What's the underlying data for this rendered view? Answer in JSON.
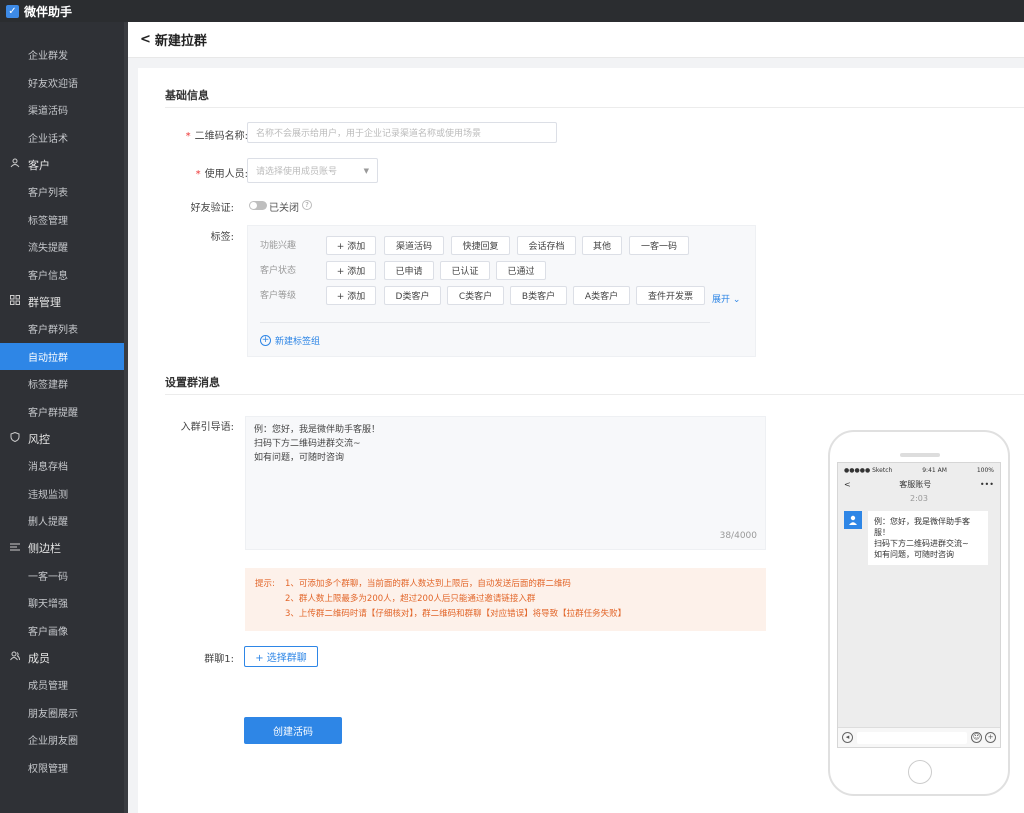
{
  "app": {
    "logo_glyph": "✓",
    "title": "微伴助手"
  },
  "sidebar": {
    "items_top": [
      "企业群发",
      "好友欢迎语",
      "渠道活码",
      "企业话术"
    ],
    "groups": [
      {
        "label": "客户",
        "icon": "person-icon",
        "items": [
          "客户列表",
          "标签管理",
          "流失提醒",
          "客户信息"
        ]
      },
      {
        "label": "群管理",
        "icon": "grid-icon",
        "items": [
          "客户群列表",
          "自动拉群",
          "标签建群",
          "客户群提醒"
        ]
      },
      {
        "label": "风控",
        "icon": "shield-icon",
        "items": [
          "消息存档",
          "违规监测",
          "删人提醒"
        ]
      },
      {
        "label": "侧边栏",
        "icon": "list-icon",
        "items": [
          "一客一码",
          "聊天增强",
          "客户画像"
        ]
      },
      {
        "label": "成员",
        "icon": "people-icon",
        "items": [
          "成员管理",
          "朋友圈展示",
          "企业朋友圈",
          "权限管理"
        ]
      }
    ],
    "active_item": "自动拉群"
  },
  "header": {
    "back_glyph": "<",
    "title": "新建拉群"
  },
  "basic": {
    "section_title": "基础信息",
    "qr_name_label": "二维码名称:",
    "qr_name_placeholder": "名称不会展示给用户，用于企业记录渠道名称或使用场景",
    "user_label": "使用人员:",
    "user_placeholder": "请选择使用成员账号",
    "verify_label": "好友验证:",
    "verify_state": "已关闭",
    "tags_label": "标签:",
    "tag_rows": [
      {
        "label": "功能兴趣",
        "chips": [
          "+ 添加",
          "渠道活码",
          "快捷回复",
          "会话存档",
          "其他",
          "一客一码"
        ]
      },
      {
        "label": "客户状态",
        "chips": [
          "+ 添加",
          "已申请",
          "已认证",
          "已通过"
        ]
      },
      {
        "label": "客户等级",
        "chips": [
          "+ 添加",
          "D类客户",
          "C类客户",
          "B类客户",
          "A类客户",
          "查件开发票"
        ]
      }
    ],
    "expand_label": "展开 ⌄",
    "new_group_label": "新建标签组"
  },
  "message": {
    "section_title": "设置群消息",
    "guide_label": "入群引导语:",
    "guide_lines": [
      "例：您好，我是微伴助手客服！",
      "扫码下方二维码进群交流~",
      "如有问题，可随时咨询"
    ],
    "counter": "38/4000",
    "tips_label": "提示:",
    "tips": [
      "1、可添加多个群聊，当前面的群人数达到上限后，自动发送后面的群二维码",
      "2、群人数上限最多为200人，超过200人后只能通过邀请链接入群",
      "3、上传群二维码时请【仔细核对】，群二维码和群聊【对应错误】将导致【拉群任务失败】"
    ],
    "group_label": "群聊1:",
    "select_group_btn": "+ 选择群聊",
    "create_btn": "创建活码"
  },
  "phone": {
    "carrier": "●●●●● Sketch",
    "time": "9:41 AM",
    "battery": "100%",
    "back": "<",
    "title": "客服账号",
    "more": "•••",
    "chat_time": "2:03",
    "bubble_lines": [
      "例：您好，我是微伴助手客服！",
      "扫码下方二维码进群交流~",
      "如有问题，可随时咨询"
    ]
  }
}
